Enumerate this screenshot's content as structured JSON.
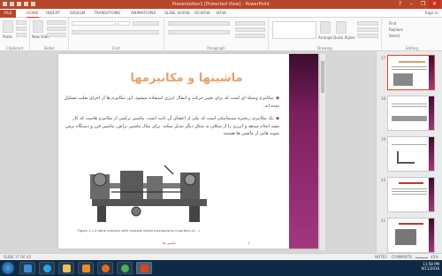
{
  "window": {
    "title": "Presentation1 [Protected View] - PowerPoint",
    "controls": [
      "?",
      "–",
      "❐",
      "✕"
    ]
  },
  "tabs": [
    "FILE",
    "HOME",
    "INSERT",
    "DESIGN",
    "TRANSITIONS",
    "ANIMATIONS",
    "SLIDE SHOW",
    "REVIEW",
    "VIEW"
  ],
  "signin": "Sign in",
  "ribbon": {
    "groups": [
      "Clipboard",
      "Slides",
      "Font",
      "Paragraph",
      "Drawing",
      "Editing"
    ],
    "paste_label": "Paste",
    "new_slide_label": "New Slide",
    "arrange_label": "Arrange",
    "quick_styles_label": "Quick Styles",
    "find_label": "Find",
    "replace_label": "Replace",
    "select_label": "Select"
  },
  "slide": {
    "title": "ماشینها و مکانیزمها",
    "bullet1": "مکانیزم وسیله ای است که برای تغییر حرکت و انتقال انرژی استفاده میشود. این مکانیزم ها از اجزای صلب تشکیل شده اند.",
    "bullet2": "یک مکانیزم، زنجیره سینماتیکی است که یکی از اعضای آن ثابت است. ماشین ترکیبی از مکانیزم هاست که کار مفید انجام میدهد و انرژی را از شکلی به شکل دیگر تبدیل میکند. برای مثال ماشین تراش، ماشین فرز و دستگاه پرس نمونه هایی از ماشین ها هستند.",
    "caption": "Figure 1-1 A lathe machine with multiple linked mechanisms (Courtesy of ...)",
    "footer_left": "ماشین ها",
    "footer_right": "1"
  },
  "thumbnails": [
    {
      "num": "17",
      "active": true
    },
    {
      "num": "18",
      "active": false
    },
    {
      "num": "19",
      "active": false
    },
    {
      "num": "20",
      "active": false
    },
    {
      "num": "21",
      "active": false
    }
  ],
  "statusbar": {
    "slide_info": "SLIDE 17 OF 42",
    "language": "ENGLISH (UNITED STATES)",
    "notes": "NOTES",
    "comments": "COMMENTS",
    "zoom": "45%"
  },
  "taskbar": {
    "apps": [
      "Internet Explorer",
      "Telegram",
      "File Explorer",
      "Media Player",
      "Firefox",
      "Chrome",
      "PowerPoint"
    ],
    "time": "11:58 PM",
    "date": "9/11/2016"
  },
  "colors": {
    "accent": "#b7472a",
    "band_dark": "#3b0d2c",
    "band_light": "#a3377f",
    "title_orange": "#e8a06a",
    "taskbar": "#0f2a45"
  }
}
